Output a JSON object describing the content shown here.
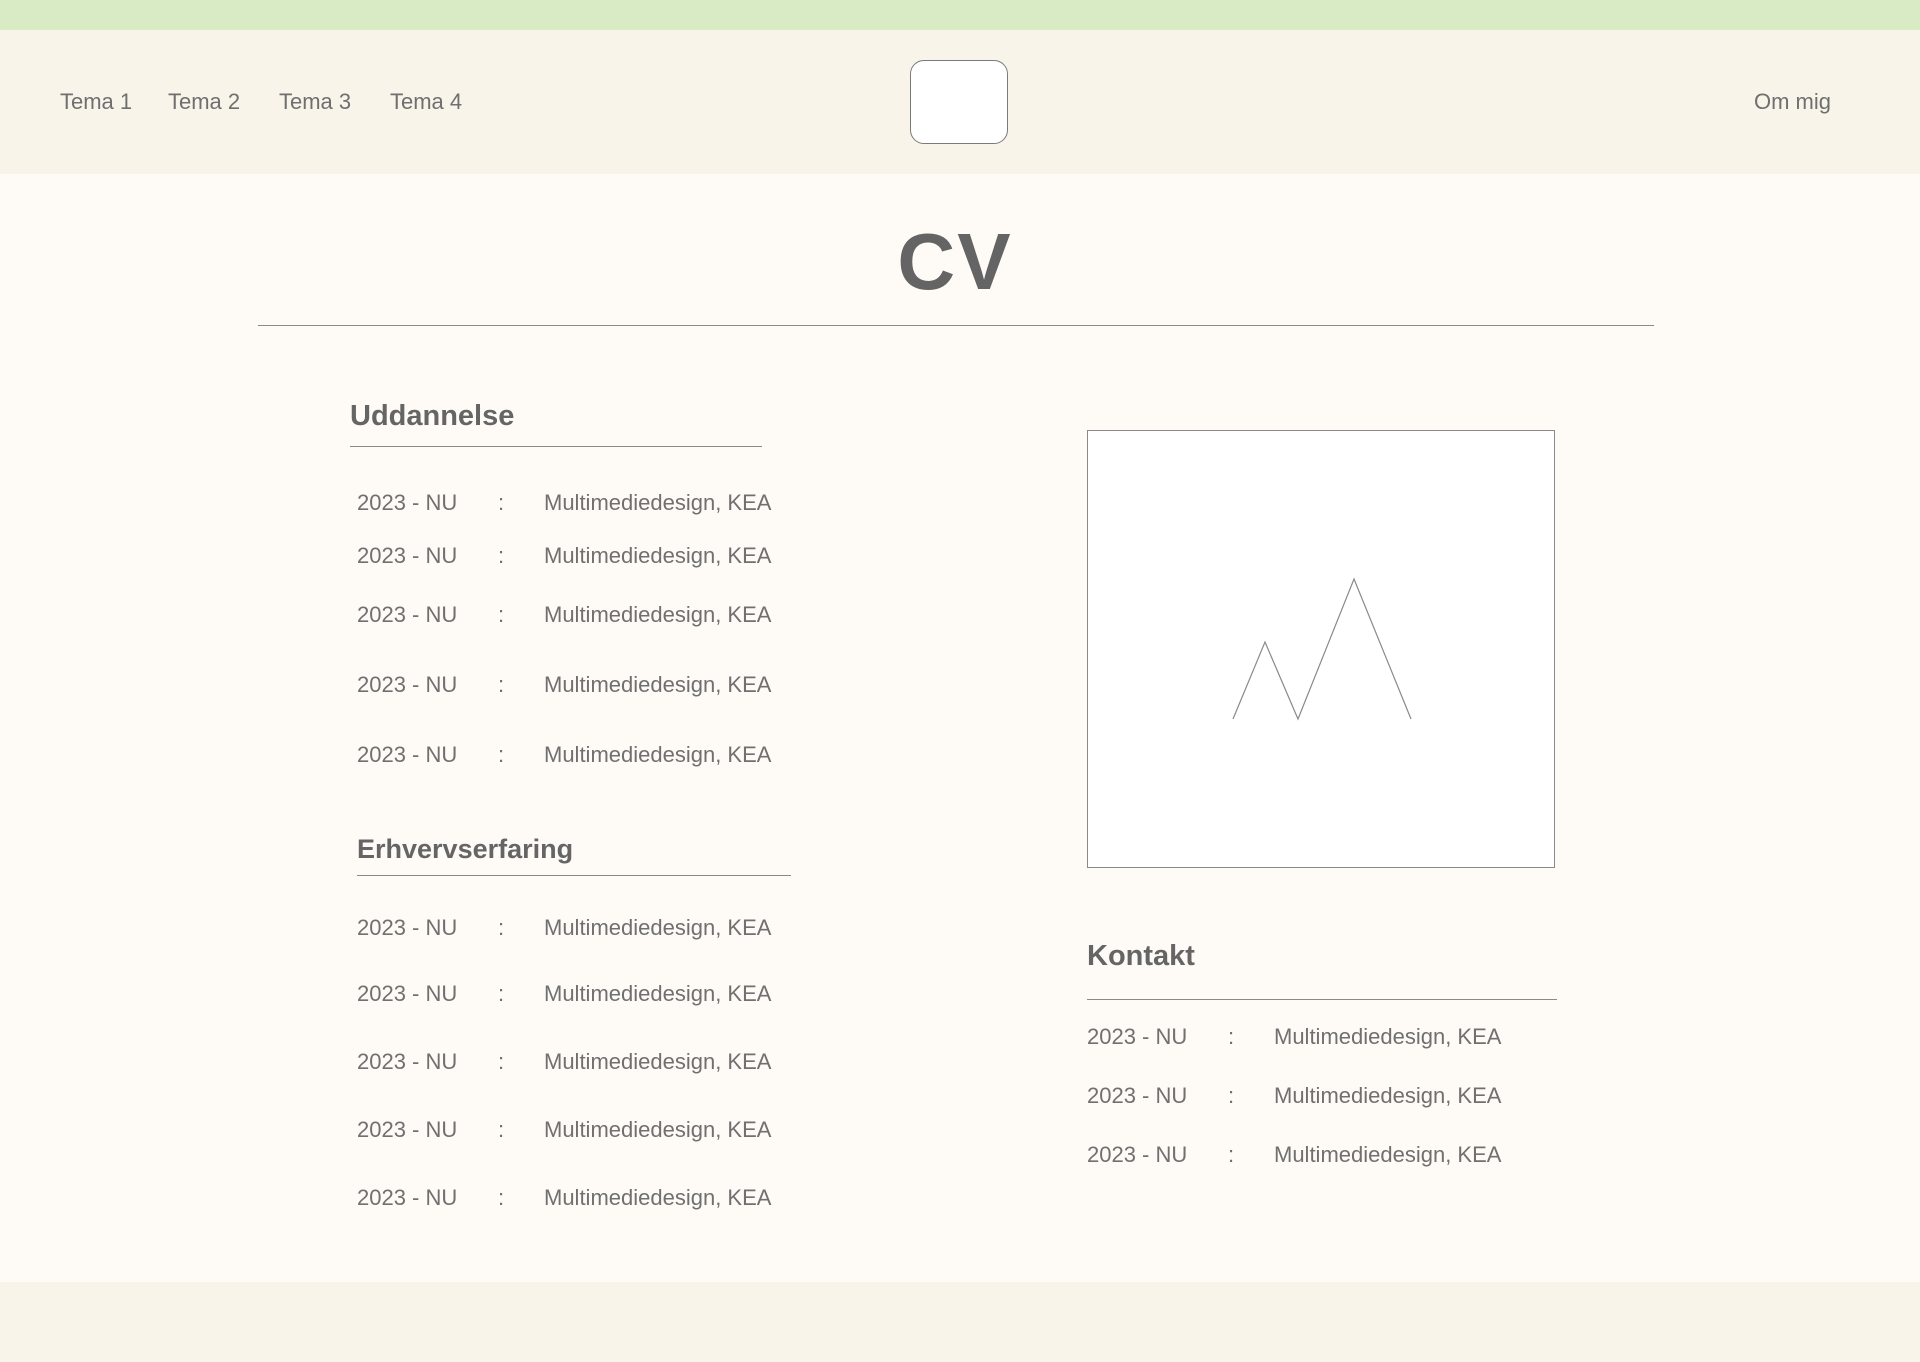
{
  "nav": {
    "items": [
      {
        "label": "Tema 1"
      },
      {
        "label": "Tema 2"
      },
      {
        "label": "Tema 3"
      },
      {
        "label": "Tema 4"
      }
    ],
    "about_label": "Om mig"
  },
  "page": {
    "title": "CV"
  },
  "education": {
    "heading": "Uddannelse",
    "rows": [
      {
        "date": "2023 - NU",
        "sep": ":",
        "desc": "Multimediedesign, KEA"
      },
      {
        "date": "2023 - NU",
        "sep": ":",
        "desc": "Multimediedesign, KEA"
      },
      {
        "date": "2023 - NU",
        "sep": ":",
        "desc": "Multimediedesign, KEA"
      },
      {
        "date": "2023 - NU",
        "sep": ":",
        "desc": "Multimediedesign, KEA"
      },
      {
        "date": "2023 - NU",
        "sep": ":",
        "desc": "Multimediedesign, KEA"
      }
    ]
  },
  "experience": {
    "heading": "Erhvervserfaring",
    "rows": [
      {
        "date": "2023 - NU",
        "sep": ":",
        "desc": "Multimediedesign, KEA"
      },
      {
        "date": "2023 - NU",
        "sep": ":",
        "desc": "Multimediedesign, KEA"
      },
      {
        "date": "2023 - NU",
        "sep": ":",
        "desc": "Multimediedesign, KEA"
      },
      {
        "date": "2023 - NU",
        "sep": ":",
        "desc": "Multimediedesign, KEA"
      },
      {
        "date": "2023 - NU",
        "sep": ":",
        "desc": "Multimediedesign, KEA"
      }
    ]
  },
  "contact": {
    "heading": "Kontakt",
    "rows": [
      {
        "date": "2023 - NU",
        "sep": ":",
        "desc": "Multimediedesign, KEA"
      },
      {
        "date": "2023 - NU",
        "sep": ":",
        "desc": "Multimediedesign, KEA"
      },
      {
        "date": "2023 - NU",
        "sep": ":",
        "desc": "Multimediedesign, KEA"
      }
    ]
  },
  "photo": {
    "icon": "image-placeholder-icon"
  },
  "colors": {
    "top_strip": "#d8ebc4",
    "header_bg": "#f9f4ea",
    "page_bg": "#fefbf6",
    "text": "#6b6b6b"
  }
}
